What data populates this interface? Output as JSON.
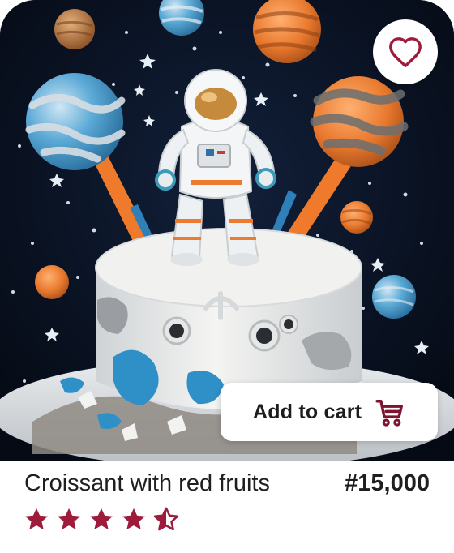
{
  "product": {
    "image_alt": "astronaut-space-cake-photo",
    "title": "Croissant with red fruits",
    "price": "#15,000",
    "rating": 4.5,
    "rating_max": 5
  },
  "actions": {
    "add_to_cart_label": "Add to cart"
  },
  "icons": {
    "favorite": "heart-outline-icon",
    "cart": "shopping-cart-icon",
    "star": "star-icon"
  },
  "colors": {
    "accent": "#9e1b3c",
    "text": "#1f1f1f",
    "hero_background": "#07101f"
  }
}
